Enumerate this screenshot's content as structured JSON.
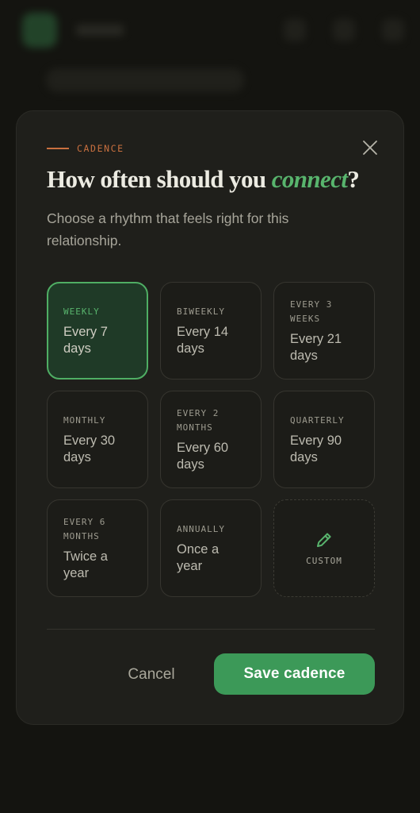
{
  "modal": {
    "eyebrow": "CADENCE",
    "title_prefix": "How often should you ",
    "title_emphasis": "connect",
    "title_suffix": "?",
    "subtitle": "Choose a rhythm that feels right for this relationship."
  },
  "options": [
    {
      "label": "WEEKLY",
      "value": "Every 7 days",
      "selected": true
    },
    {
      "label": "BIWEEKLY",
      "value": "Every 14 days",
      "selected": false
    },
    {
      "label": "EVERY 3 WEEKS",
      "value": "Every 21 days",
      "selected": false
    },
    {
      "label": "MONTHLY",
      "value": "Every 30 days",
      "selected": false
    },
    {
      "label": "EVERY 2 MONTHS",
      "value": "Every 60 days",
      "selected": false
    },
    {
      "label": "QUARTERLY",
      "value": "Every 90 days",
      "selected": false
    },
    {
      "label": "EVERY 6 MONTHS",
      "value": "Twice a year",
      "selected": false
    },
    {
      "label": "ANNUALLY",
      "value": "Once a year",
      "selected": false
    }
  ],
  "custom": {
    "label": "CUSTOM",
    "icon": "pencil-icon"
  },
  "actions": {
    "cancel": "Cancel",
    "save": "Save cadence"
  },
  "icons": {
    "close": "close-icon"
  },
  "colors": {
    "accent_green": "#3c9958",
    "selected_border": "#4fae64",
    "eyebrow": "#c9703f",
    "modal_bg": "#1f1f1b"
  }
}
